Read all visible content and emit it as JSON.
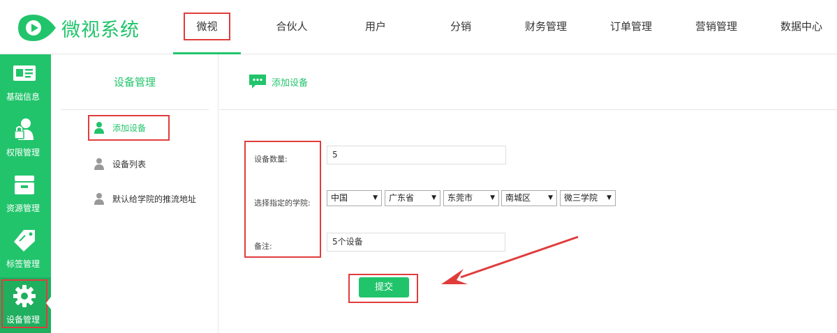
{
  "brand": {
    "name": "微视系统"
  },
  "nav": [
    {
      "label": "微视",
      "active": true
    },
    {
      "label": "合伙人"
    },
    {
      "label": "用户"
    },
    {
      "label": "分销"
    },
    {
      "label": "财务管理"
    },
    {
      "label": "订单管理"
    },
    {
      "label": "营销管理"
    },
    {
      "label": "数据中心"
    }
  ],
  "sidebar": [
    {
      "label": "基础信息",
      "icon": "id-card-icon"
    },
    {
      "label": "权限管理",
      "icon": "user-lock-icon"
    },
    {
      "label": "资源管理",
      "icon": "archive-box-icon"
    },
    {
      "label": "标签管理",
      "icon": "tag-icon"
    },
    {
      "label": "设备管理",
      "icon": "gear-icon",
      "active": true
    }
  ],
  "submenu": {
    "title": "设备管理",
    "items": [
      {
        "label": "添加设备",
        "active": true
      },
      {
        "label": "设备列表"
      },
      {
        "label": "默认给学院的推流地址"
      }
    ]
  },
  "main": {
    "title": "添加设备",
    "form": {
      "count_label": "设备数量:",
      "count_value": "5",
      "college_label": "选择指定的学院:",
      "selects": [
        "中国",
        "广东省",
        "东莞市",
        "南城区",
        "微三学院"
      ],
      "note_label": "备注:",
      "note_value": "5个设备",
      "submit_label": "提交"
    }
  },
  "colors": {
    "brand": "#22c46b",
    "annotation": "#e03c3c"
  }
}
